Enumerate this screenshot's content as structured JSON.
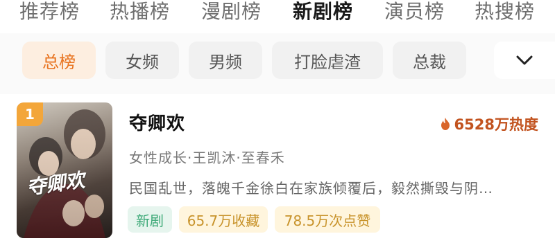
{
  "top_tabs": [
    {
      "label": "推荐榜"
    },
    {
      "label": "热播榜"
    },
    {
      "label": "漫剧榜"
    },
    {
      "label": "新剧榜",
      "active": true
    },
    {
      "label": "演员榜"
    },
    {
      "label": "热搜榜"
    }
  ],
  "filters": [
    {
      "label": "总榜",
      "active": true
    },
    {
      "label": "女频"
    },
    {
      "label": "男频"
    },
    {
      "label": "打脸虐渣"
    },
    {
      "label": "总裁"
    }
  ],
  "more_icon": "chevron-down-icon",
  "item": {
    "rank": "1",
    "title": "夺卿欢",
    "heat": "6528万热度",
    "heat_icon": "flame-icon",
    "tags": "女性成长·王凯沐·至春禾",
    "description": "民国乱世，落魄千金徐白在家族倾覆后，毅然撕毁与阴…",
    "badges": {
      "new": "新剧",
      "favorites": "65.7万收藏",
      "likes": "78.5万次点赞"
    },
    "poster_text": "夺卿欢"
  },
  "colors": {
    "accent": "#e8731f",
    "heat": "#c2531f",
    "rank_badge": "#f3a63a",
    "new_badge": "#3aa876"
  }
}
